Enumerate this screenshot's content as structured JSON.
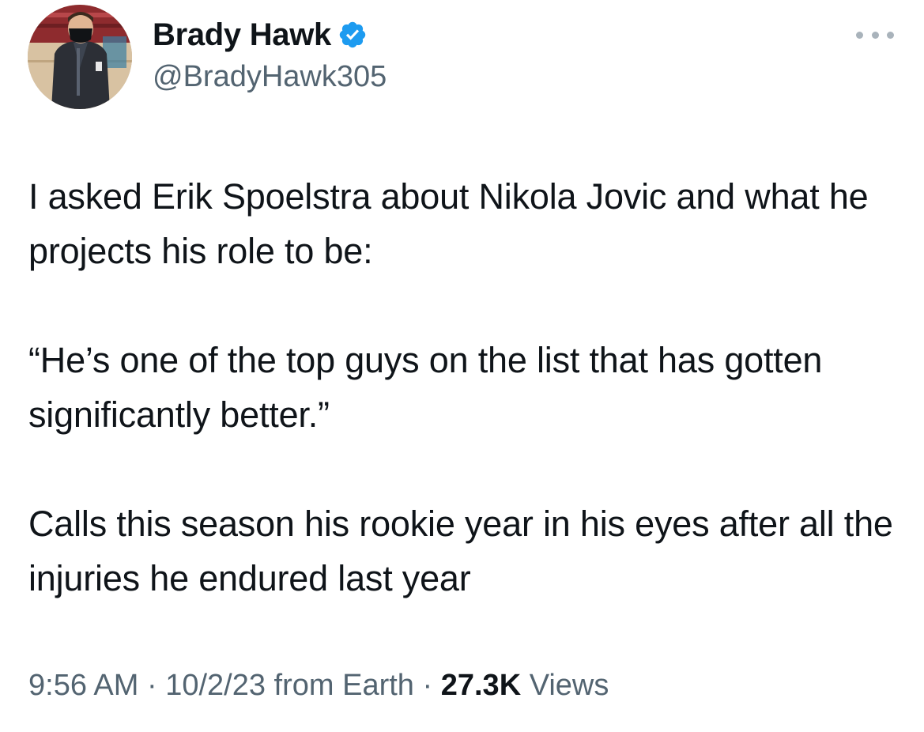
{
  "author": {
    "display_name": "Brady Hawk",
    "handle": "@BradyHawk305",
    "verified": true,
    "verified_color": "#1d9bf0"
  },
  "menu": {
    "icon": "more-horizontal-icon"
  },
  "tweet": {
    "paragraphs": [
      "I asked Erik Spoelstra about Nikola Jovic and what he projects his role to be:",
      "“He’s one of the top guys on the list that has gotten significantly better.”",
      "Calls this season his rookie year in his eyes after all the injuries he endured last year"
    ]
  },
  "meta": {
    "time": "9:56 AM",
    "sep1": " · ",
    "date": "10/2/23",
    "source": " from Earth",
    "sep2": " · ",
    "views_count": "27.3K",
    "views_label": " Views"
  },
  "colors": {
    "text": "#0f1419",
    "secondary": "#536471",
    "accent": "#1d9bf0"
  }
}
